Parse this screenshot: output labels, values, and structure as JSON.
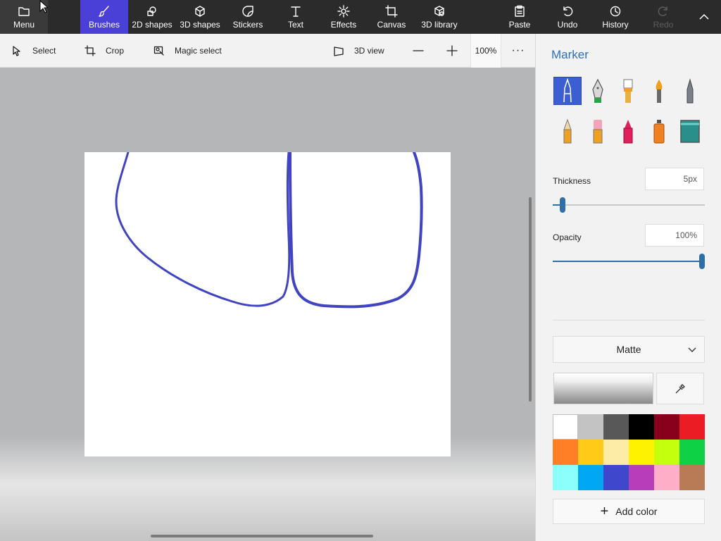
{
  "topbar": {
    "menu": {
      "label": "Menu",
      "icon": "folder-icon"
    },
    "tools": [
      {
        "label": "Brushes",
        "icon": "brush-icon",
        "active": true
      },
      {
        "label": "2D shapes",
        "icon": "2d-shapes-icon"
      },
      {
        "label": "3D shapes",
        "icon": "3d-shapes-icon"
      },
      {
        "label": "Stickers",
        "icon": "stickers-icon"
      },
      {
        "label": "Text",
        "icon": "text-icon"
      },
      {
        "label": "Effects",
        "icon": "effects-icon"
      },
      {
        "label": "Canvas",
        "icon": "canvas-icon"
      },
      {
        "label": "3D library",
        "icon": "3d-library-icon"
      }
    ],
    "actions": [
      {
        "label": "Paste",
        "icon": "paste-icon"
      },
      {
        "label": "Undo",
        "icon": "undo-icon"
      },
      {
        "label": "History",
        "icon": "history-icon"
      },
      {
        "label": "Redo",
        "icon": "redo-icon",
        "disabled": true
      }
    ]
  },
  "subbar": {
    "select": "Select",
    "crop": "Crop",
    "magic_select": "Magic select",
    "view_3d": "3D view",
    "zoom": "100%",
    "more": "···"
  },
  "panel": {
    "title": "Marker",
    "brushes": [
      "marker",
      "calligraphy-pen",
      "oil-brush",
      "watercolor",
      "pixel-pen",
      "pencil",
      "eraser",
      "crayon",
      "spray-can",
      "fill"
    ],
    "thickness": {
      "label": "Thickness",
      "value": "5px",
      "level_pct": 5
    },
    "opacity": {
      "label": "Opacity",
      "value": "100%",
      "level_pct": 100
    },
    "finish": "Matte",
    "add_color": "Add color",
    "palette": [
      "#ffffff",
      "#c3c3c3",
      "#585858",
      "#000000",
      "#88001b",
      "#ec1c24",
      "#ff7f27",
      "#ffca18",
      "#fdeca6",
      "#fff200",
      "#c4ff0e",
      "#0ed145",
      "#8cfffb",
      "#00a8f3",
      "#3f48cc",
      "#b83dba",
      "#ffaec8",
      "#b97a56"
    ]
  },
  "canvas": {
    "stroke_color": "#4144c0"
  }
}
